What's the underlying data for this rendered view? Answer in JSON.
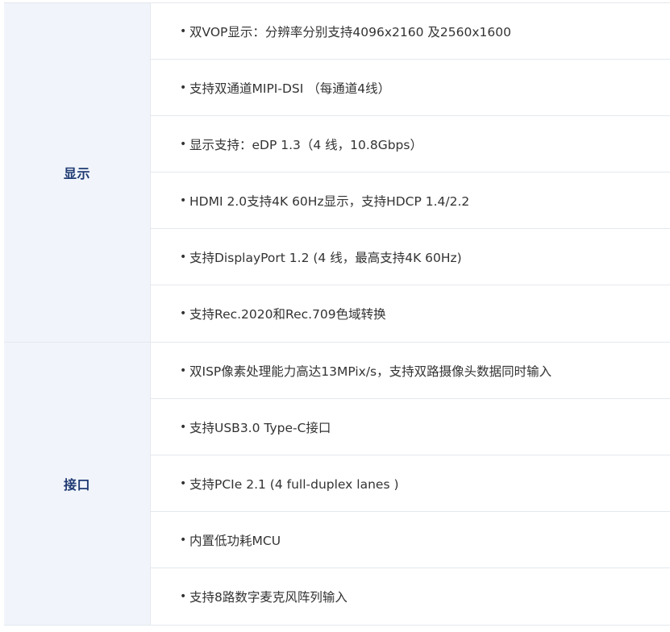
{
  "groups": [
    {
      "label": "显示",
      "items": [
        "双VOP显示：分辨率分别支持4096x2160 及2560x1600",
        "支持双通道MIPI-DSI （每通道4线）",
        "显示支持：eDP 1.3（4 线，10.8Gbps）",
        "HDMI 2.0支持4K 60Hz显示，支持HDCP 1.4/2.2",
        "支持DisplayPort 1.2 (4 线，最高支持4K 60Hz)",
        "支持Rec.2020和Rec.709色域转换"
      ]
    },
    {
      "label": "接口",
      "items": [
        "双ISP像素处理能力高达13MPix/s，支持双路摄像头数据同时输入",
        "支持USB3.0 Type-C接口",
        "支持PCIe 2.1 (4 full-duplex lanes )",
        "内置低功耗MCU",
        "支持8路数字麦克风阵列输入"
      ]
    }
  ],
  "bullet_symbol": "•",
  "colors": {
    "label_bg": "#f1f5fb",
    "label_text": "#1f3a73",
    "border": "#e4e8ee",
    "body_text": "#333333"
  }
}
